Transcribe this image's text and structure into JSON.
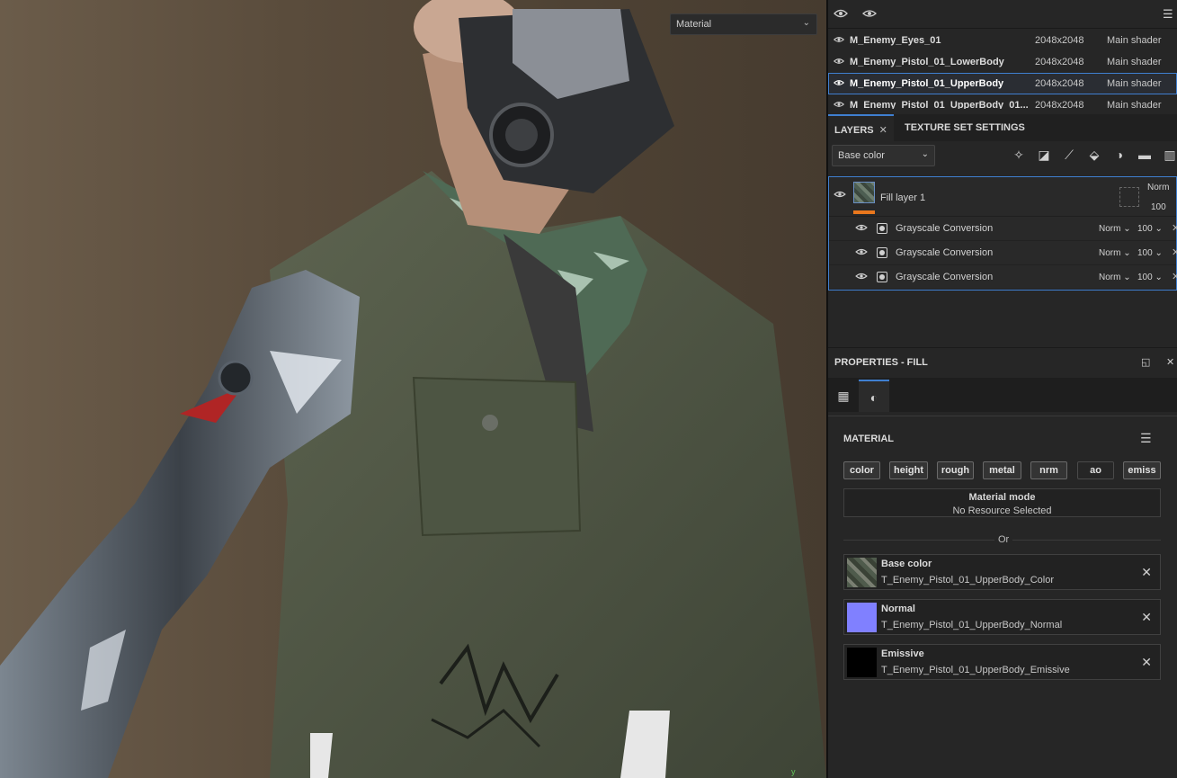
{
  "viewport": {
    "mode_select": "Material",
    "axis_label": "y"
  },
  "texture_sets": [
    {
      "name": "M_Enemy_Eyes_01",
      "resolution": "2048x2048",
      "shader": "Main shader",
      "selected": false
    },
    {
      "name": "M_Enemy_Pistol_01_LowerBody",
      "resolution": "2048x2048",
      "shader": "Main shader",
      "selected": false
    },
    {
      "name": "M_Enemy_Pistol_01_UpperBody",
      "resolution": "2048x2048",
      "shader": "Main shader",
      "selected": true
    },
    {
      "name": "M_Enemy_Pistol_01_UpperBody_01...",
      "resolution": "2048x2048",
      "shader": "Main shader",
      "selected": false
    }
  ],
  "tabs": {
    "layers": "LAYERS",
    "texture_set_settings": "TEXTURE SET SETTINGS"
  },
  "layers_toolbar": {
    "channel_select": "Base color"
  },
  "layer_stack": {
    "fill_layer": {
      "name": "Fill layer 1",
      "blend": "Norm",
      "opacity": "100"
    },
    "effects": [
      {
        "name": "Grayscale Conversion",
        "blend": "Norm",
        "opacity": "100"
      },
      {
        "name": "Grayscale Conversion",
        "blend": "Norm",
        "opacity": "100"
      },
      {
        "name": "Grayscale Conversion",
        "blend": "Norm",
        "opacity": "100"
      }
    ]
  },
  "properties": {
    "title": "PROPERTIES - FILL",
    "material_title": "MATERIAL",
    "channels": [
      {
        "label": "color",
        "on": true
      },
      {
        "label": "height",
        "on": true
      },
      {
        "label": "rough",
        "on": true
      },
      {
        "label": "metal",
        "on": true
      },
      {
        "label": "nrm",
        "on": true
      },
      {
        "label": "ao",
        "on": false
      },
      {
        "label": "emiss",
        "on": true
      }
    ],
    "material_mode_label": "Material mode",
    "material_mode_value": "No Resource Selected",
    "or_text": "Or",
    "slots": [
      {
        "name": "Base color",
        "file": "T_Enemy_Pistol_01_UpperBody_Color",
        "thumb": "#55604f"
      },
      {
        "name": "Normal",
        "file": "T_Enemy_Pistol_01_UpperBody_Normal",
        "thumb": "#8080ff"
      },
      {
        "name": "Emissive",
        "file": "T_Enemy_Pistol_01_UpperBody_Emissive",
        "thumb": "#000000"
      }
    ]
  },
  "colors": {
    "accent": "#3f7fd0",
    "layer_marker": "#e9771d"
  }
}
